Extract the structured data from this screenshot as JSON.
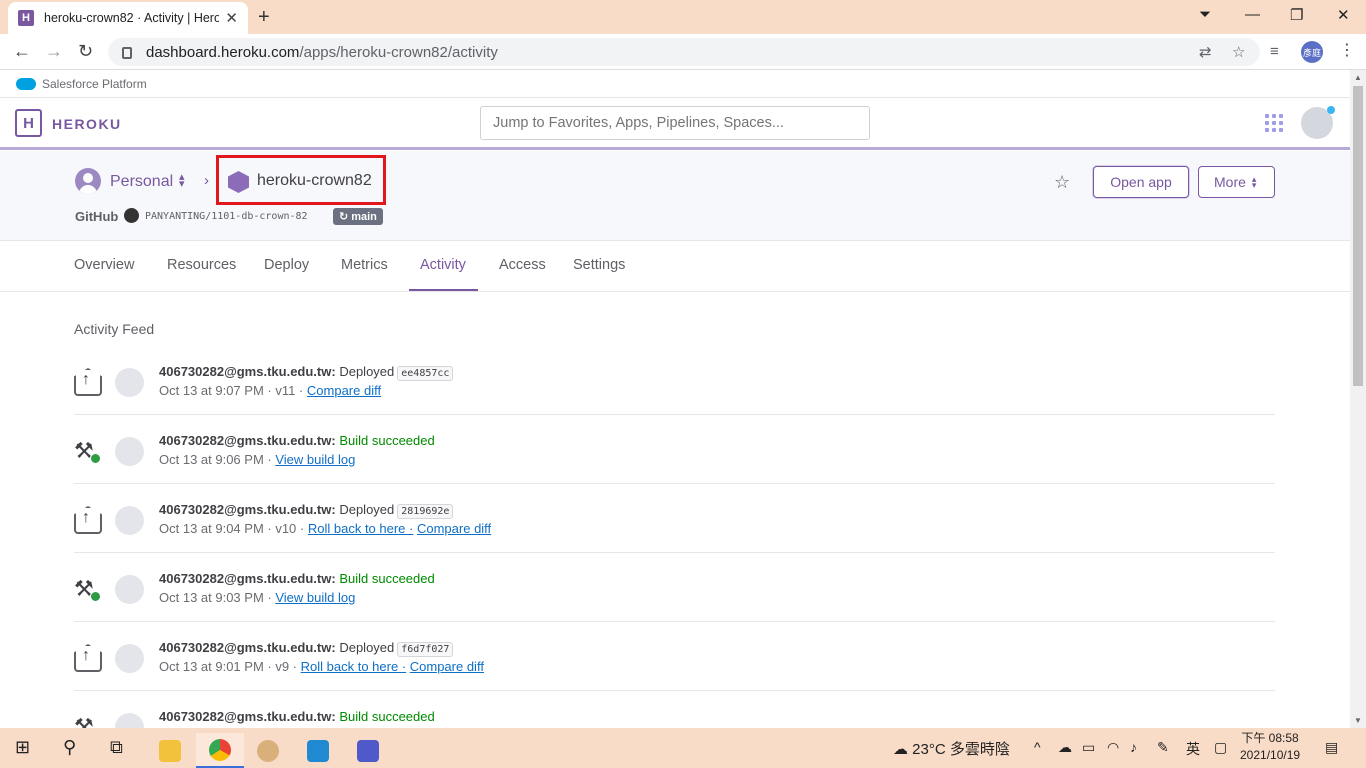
{
  "browser": {
    "tab_title": "heroku-crown82 · Activity | Heroku",
    "new_tab": "+",
    "url_domain": "dashboard.heroku.com",
    "url_path": "/apps/heroku-crown82/activity",
    "profile": "彥庭"
  },
  "salesforce": {
    "label": "Salesforce Platform"
  },
  "heroku": {
    "logo_letter": "H",
    "logo_text": "HEROKU",
    "search_placeholder": "Jump to Favorites, Apps, Pipelines, Spaces..."
  },
  "app": {
    "personal": "Personal",
    "name": "heroku-crown82",
    "github_label": "GitHub",
    "repo": "PANYANTING/1101-db-crown-82",
    "branch": "main",
    "open_app": "Open app",
    "more": "More"
  },
  "tabs": [
    "Overview",
    "Resources",
    "Deploy",
    "Metrics",
    "Activity",
    "Access",
    "Settings"
  ],
  "feed": {
    "title": "Activity Feed",
    "items": [
      {
        "type": "deploy",
        "email": "406730282@gms.tku.edu.tw:",
        "action": "Deployed",
        "sha": "ee4857cc",
        "time": "Oct 13 at 9:07 PM · v11 ·",
        "link1": "Compare diff",
        "link2": ""
      },
      {
        "type": "build",
        "email": "406730282@gms.tku.edu.tw:",
        "action": "Build succeeded",
        "sha": "",
        "time": "Oct 13 at 9:06 PM ·",
        "link1": "View build log",
        "link2": ""
      },
      {
        "type": "deploy",
        "email": "406730282@gms.tku.edu.tw:",
        "action": "Deployed",
        "sha": "2819692e",
        "time": "Oct 13 at 9:04 PM · v10 ·",
        "link1": "Roll back to here ·",
        "link2": "Compare diff"
      },
      {
        "type": "build",
        "email": "406730282@gms.tku.edu.tw:",
        "action": "Build succeeded",
        "sha": "",
        "time": "Oct 13 at 9:03 PM ·",
        "link1": "View build log",
        "link2": ""
      },
      {
        "type": "deploy",
        "email": "406730282@gms.tku.edu.tw:",
        "action": "Deployed",
        "sha": "f6d7f027",
        "time": "Oct 13 at 9:01 PM · v9 ·",
        "link1": "Roll back to here ·",
        "link2": "Compare diff"
      },
      {
        "type": "build",
        "email": "406730282@gms.tku.edu.tw:",
        "action": "Build succeeded",
        "sha": "",
        "time": "",
        "link1": "",
        "link2": ""
      }
    ]
  },
  "taskbar": {
    "weather": "23°C 多雲時陰",
    "ime": "英",
    "time": "下午 08:58",
    "date": "2021/10/19"
  }
}
